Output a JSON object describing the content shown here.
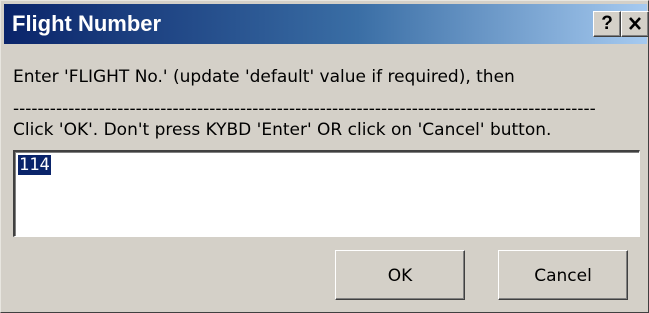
{
  "window": {
    "title": "Flight Number",
    "help_label": "?",
    "close_label": "✕"
  },
  "prompt": {
    "line1": "Enter 'FLIGHT No.' (update 'default' value if required), then",
    "separator": "-----------------------------------------------------------------------------------------------",
    "line2": "Click 'OK'.  Don't press KYBD 'Enter' OR click on 'Cancel' button."
  },
  "input": {
    "value": "114"
  },
  "buttons": {
    "ok_label": "OK",
    "cancel_label": "Cancel"
  },
  "colors": {
    "titlebar_start": "#0a246a",
    "titlebar_end": "#a6caf0",
    "dialog_bg": "#d4d0c8",
    "selection": "#0a246a"
  }
}
